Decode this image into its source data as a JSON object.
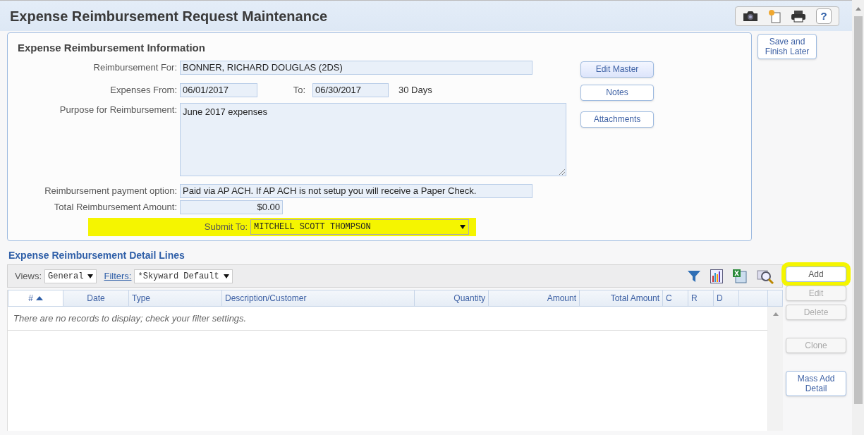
{
  "window": {
    "title": "Expense Reimbursement Request Maintenance"
  },
  "header_tools": [
    {
      "kind": "camera"
    },
    {
      "kind": "note"
    },
    {
      "kind": "print"
    },
    {
      "kind": "help",
      "label": "?"
    }
  ],
  "info": {
    "title": "Expense Reimbursement Information",
    "reimbursement_for": {
      "label": "Reimbursement For:",
      "value": "BONNER, RICHARD DOUGLAS  (2DS)"
    },
    "expenses_from": {
      "label": "Expenses From:",
      "value": "06/01/2017"
    },
    "expenses_to": {
      "label": "To:",
      "value": "06/30/2017"
    },
    "days": "30 Days",
    "purpose": {
      "label": "Purpose for Reimbursement:",
      "value": "June 2017 expenses"
    },
    "payment_option": {
      "label": "Reimbursement payment option:",
      "value": "Paid via AP ACH.  If AP ACH is not setup you will receive a Paper Check."
    },
    "total": {
      "label": "Total Reimbursement Amount:",
      "value": "$0.00"
    },
    "submit_to": {
      "label": "Submit To:",
      "value": "MITCHELL SCOTT THOMPSON",
      "highlighted": true
    },
    "buttons": [
      "Edit Master",
      "Notes",
      "Attachments"
    ]
  },
  "save_button": {
    "label": "Save and Finish Later"
  },
  "detail": {
    "title": "Expense Reimbursement Detail Lines",
    "views": {
      "label": "Views:",
      "value": "General"
    },
    "filters": {
      "label": "Filters:",
      "value": "*Skyward Default"
    },
    "tools": [
      {
        "kind": "filter"
      },
      {
        "kind": "chart"
      },
      {
        "kind": "excel"
      },
      {
        "kind": "preview"
      }
    ],
    "columns": [
      {
        "label": "#",
        "sorted": true
      },
      {
        "label": "Date",
        "sorted": false
      },
      {
        "label": "Type",
        "sorted": false
      },
      {
        "label": "Description/Customer",
        "sorted": false
      },
      {
        "label": "Quantity",
        "sorted": false
      },
      {
        "label": "Amount",
        "sorted": false
      },
      {
        "label": "Total Amount",
        "sorted": false
      },
      {
        "label": "C",
        "sorted": false
      },
      {
        "label": "R",
        "sorted": false
      },
      {
        "label": "D",
        "sorted": false
      }
    ],
    "empty_message": "There are no records to display; check your filter settings.",
    "buttons": [
      {
        "label": "Add",
        "disabled": false,
        "highlighted": true
      },
      {
        "label": "Edit",
        "disabled": true,
        "highlighted": false
      },
      {
        "label": "Delete",
        "disabled": true,
        "highlighted": false
      },
      {
        "label": "Clone",
        "disabled": true,
        "highlighted": false
      },
      {
        "label": "Mass Add Detail",
        "disabled": false,
        "highlighted": false
      }
    ]
  }
}
